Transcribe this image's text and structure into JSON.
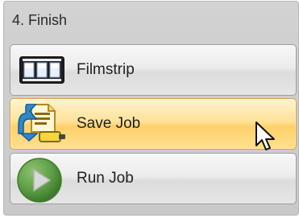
{
  "section": {
    "title": "4. Finish"
  },
  "buttons": [
    {
      "label": "Filmstrip",
      "icon": "filmstrip-icon"
    },
    {
      "label": "Save Job",
      "icon": "save-job-icon"
    },
    {
      "label": "Run Job",
      "icon": "play-icon"
    }
  ],
  "colors": {
    "panel_bg": "#cfcfcf",
    "button_bg": "#ececec",
    "hover_bg": "#ffd774",
    "hover_border": "#d9a23b",
    "play_green": "#5f9f47",
    "save_blue": "#2f87c9"
  },
  "state": {
    "hovered_button": "Save Job"
  }
}
